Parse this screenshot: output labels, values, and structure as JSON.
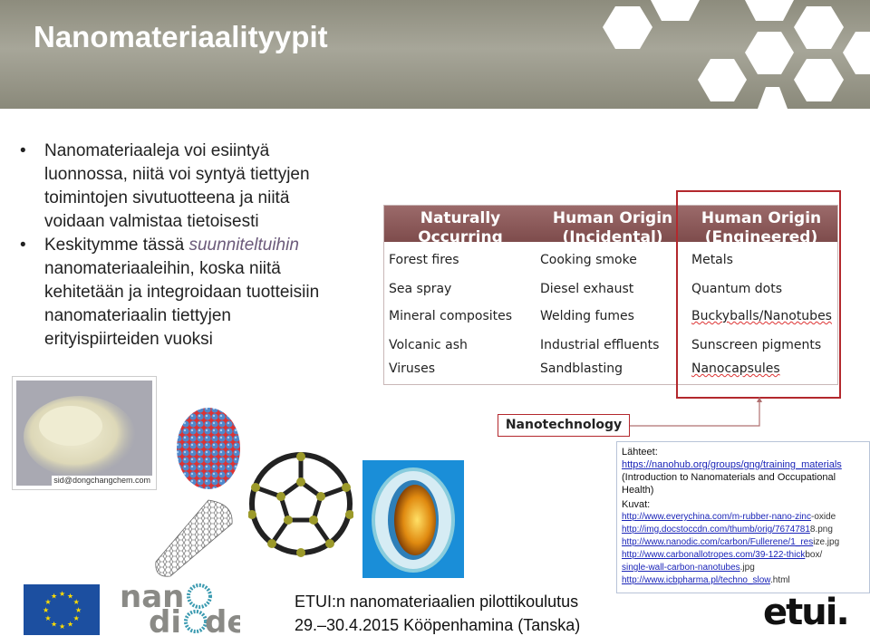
{
  "title": "Nanomateriaalityypit",
  "bullets": [
    {
      "lines": [
        "Nanomateriaaleja voi esiintyä",
        "luonnossa, niitä voi syntyä tiettyjen",
        "toimintojen sivutuotteena ja niitä",
        "voidaan valmistaa tietoisesti"
      ]
    },
    {
      "pre": "Keskitymme tässä ",
      "em": "suunniteltuihin",
      "lines": [
        "nanomateriaaleihin, koska niitä",
        "kehitetään ja integroidaan tuotteisiin",
        "nanomateriaalin tiettyjen",
        "erityispiirteiden vuoksi"
      ]
    }
  ],
  "table": {
    "headers": [
      [
        "Naturally",
        "Occurring"
      ],
      [
        "Human Origin",
        "(Incidental)"
      ],
      [
        "Human Origin",
        "(Engineered)"
      ]
    ],
    "columns": [
      [
        "Forest fires",
        "Sea spray",
        "Mineral composites",
        "Volcanic ash",
        "Viruses"
      ],
      [
        "Cooking smoke",
        "Diesel exhaust",
        "Welding fumes",
        "Industrial effluents",
        "Sandblasting"
      ],
      [
        "Metals",
        "Quantum dots",
        "Buckyballs/Nanotubes",
        "Sunscreen pigments",
        "Nanocapsules"
      ]
    ],
    "header_color": "#8a5757",
    "highlight_color": "#b3282d"
  },
  "nanotech_label": "Nanotechnology",
  "sources": {
    "heading": "Lähteet:",
    "link": "https://nanohub.org/groups/gng/training_materials",
    "desc": "(Introduction to Nanomaterials and Occupational Health)",
    "images_heading": "Kuvat:",
    "image_links": [
      {
        "link": "http://www.everychina.com/m-rubber-nano-zinc",
        "tail": "-oxide"
      },
      {
        "link": "http://img.docstoccdn.com/thumb/orig/7674781",
        "tail": "8.png"
      },
      {
        "link": "http://www.nanodic.com/carbon/Fullerene/1_res",
        "tail": "ize.jpg"
      },
      {
        "link": "http://www.carbonallotropes.com/39-122-thick",
        "tail": "box/"
      },
      {
        "link": "single-wall-carbon-nanotubes",
        "tail": ".jpg"
      },
      {
        "link": "http://www.icbpharma.pl/techno_slow",
        "tail": ".html"
      }
    ]
  },
  "photo_watermark": "sid@dongchangchem.com",
  "footer": {
    "line1": "ETUI:n nanomateriaalien pilottikoulutus",
    "line2": "29.–30.4.2015 Kööpenhamina (Tanska)"
  },
  "logos": {
    "nanodiode": [
      "nano",
      "diode"
    ],
    "etui": "etui."
  }
}
